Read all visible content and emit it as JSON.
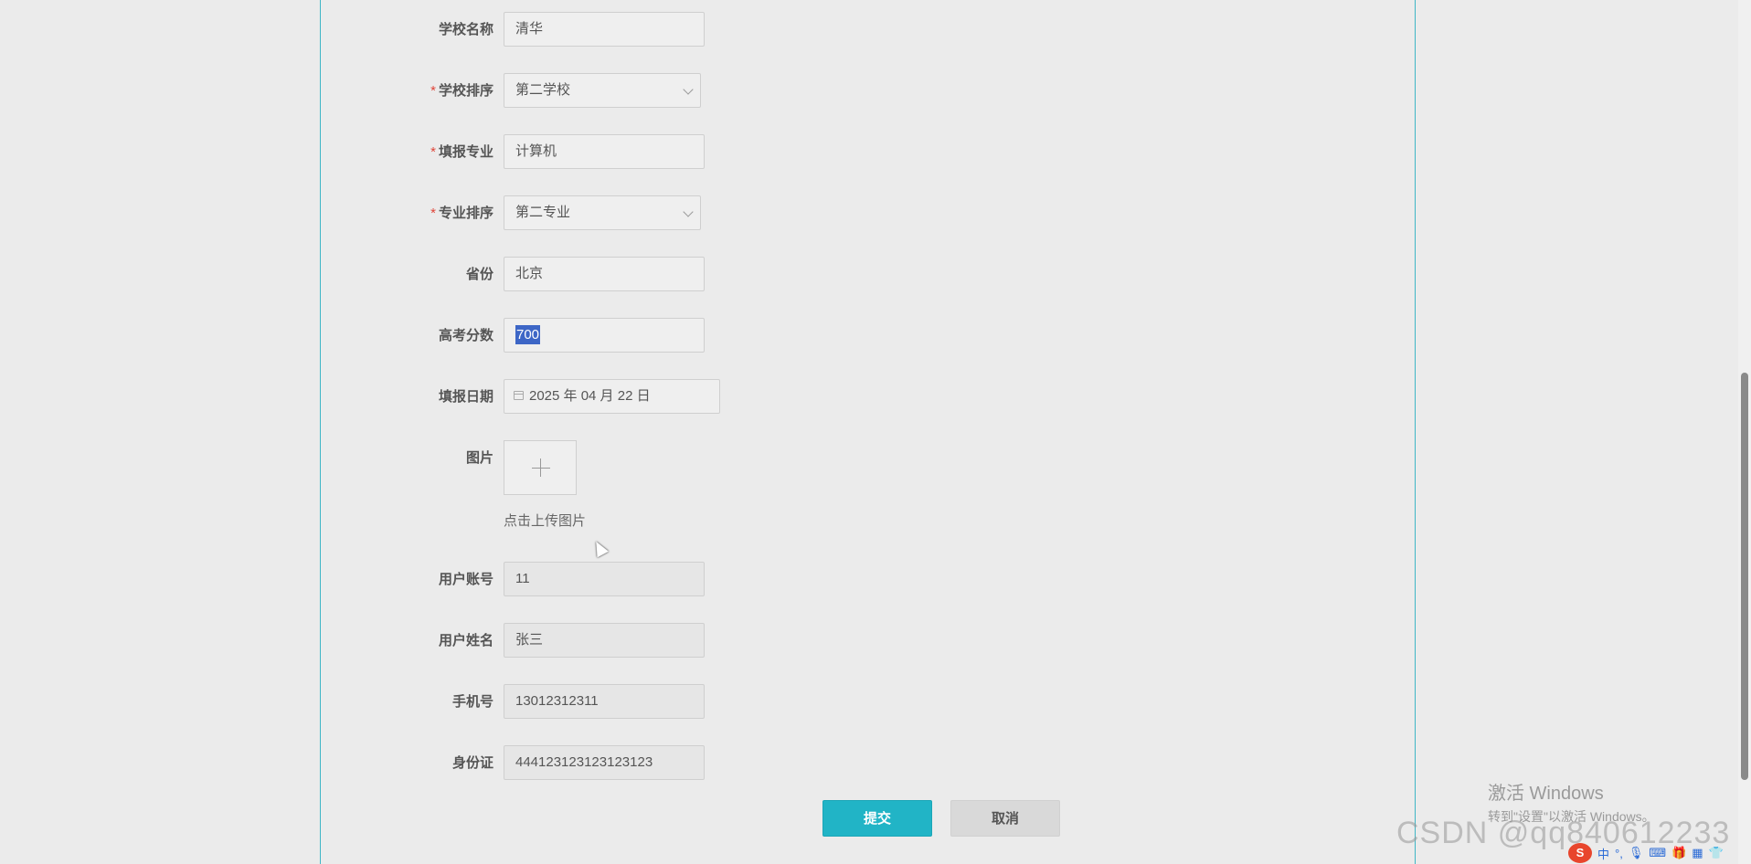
{
  "form": {
    "school_name": {
      "label": "学校名称",
      "value": "清华"
    },
    "school_rank": {
      "label": "学校排序",
      "value": "第二学校"
    },
    "major": {
      "label": "填报专业",
      "value": "计算机"
    },
    "major_rank": {
      "label": "专业排序",
      "value": "第二专业"
    },
    "province": {
      "label": "省份",
      "value": "北京"
    },
    "score": {
      "label": "高考分数",
      "value": "700"
    },
    "date": {
      "label": "填报日期",
      "value": "2025 年 04 月 22 日"
    },
    "image": {
      "label": "图片",
      "hint": "点击上传图片"
    },
    "account": {
      "label": "用户账号",
      "value": "11"
    },
    "username": {
      "label": "用户姓名",
      "value": "张三"
    },
    "phone": {
      "label": "手机号",
      "value": "13012312311"
    },
    "id_card": {
      "label": "身份证",
      "value": "444123123123123123"
    },
    "required_mark": "*"
  },
  "buttons": {
    "submit": "提交",
    "cancel": "取消"
  },
  "overlay": {
    "activate_title": "激活 Windows",
    "activate_sub": "转到\"设置\"以激活 Windows。",
    "watermark": "CSDN @qq840612233"
  },
  "tray": {
    "ime": "S",
    "lang": "中"
  },
  "colors": {
    "accent": "#21b4c6",
    "required": "#e0463a",
    "selection": "#3d66c6"
  }
}
